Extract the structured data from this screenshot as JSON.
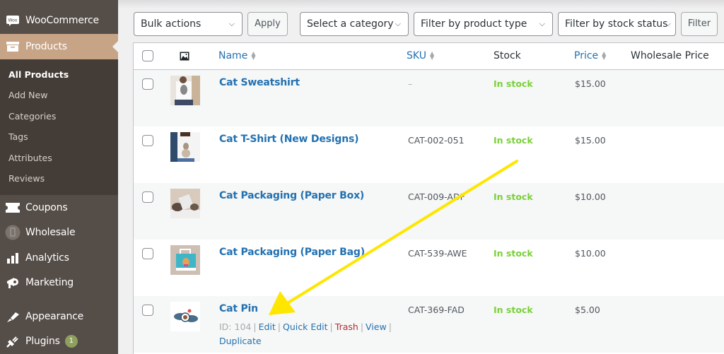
{
  "sidebar": {
    "items": [
      {
        "label": "WooCommerce",
        "icon": "woo-icon"
      },
      {
        "label": "Products",
        "icon": "archive-box-icon",
        "active": true
      },
      {
        "label": "Coupons",
        "icon": "ticket-icon"
      },
      {
        "label": "Wholesale",
        "icon": "wholesale-icon"
      },
      {
        "label": "Analytics",
        "icon": "bar-chart-icon"
      },
      {
        "label": "Marketing",
        "icon": "megaphone-icon"
      },
      {
        "label": "Appearance",
        "icon": "paintbrush-icon"
      },
      {
        "label": "Plugins",
        "icon": "plugin-icon",
        "badge": "1"
      }
    ],
    "submenu": [
      {
        "label": "All Products",
        "current": true
      },
      {
        "label": "Add New"
      },
      {
        "label": "Categories"
      },
      {
        "label": "Tags"
      },
      {
        "label": "Attributes"
      },
      {
        "label": "Reviews"
      }
    ],
    "woo_logo_text": "Woo"
  },
  "filters": {
    "bulk_actions": "Bulk actions",
    "apply": "Apply",
    "category": "Select a category",
    "product_type": "Filter by product type",
    "stock_status": "Filter by stock status",
    "filter": "Filter"
  },
  "table": {
    "headers": {
      "name": "Name",
      "sku": "SKU",
      "stock": "Stock",
      "price": "Price",
      "wholesale_price": "Wholesale Price"
    },
    "rows": [
      {
        "name": "Cat Sweatshirt",
        "sku": "–",
        "stock": "In stock",
        "price": "$15.00",
        "wholesale_price": ""
      },
      {
        "name": "Cat T-Shirt (New Designs)",
        "sku": "CAT-002-051",
        "stock": "In stock",
        "price": "$15.00",
        "wholesale_price": ""
      },
      {
        "name": "Cat Packaging (Paper Box)",
        "sku": "CAT-009-ADF",
        "stock": "In stock",
        "price": "$10.00",
        "wholesale_price": ""
      },
      {
        "name": "Cat Packaging (Paper Bag)",
        "sku": "CAT-539-AWE",
        "stock": "In stock",
        "price": "$10.00",
        "wholesale_price": ""
      },
      {
        "name": "Cat Pin",
        "sku": "CAT-369-FAD",
        "stock": "In stock",
        "price": "$5.00",
        "wholesale_price": "",
        "row_actions": {
          "id": "ID: 104",
          "edit": "Edit",
          "quick_edit": "Quick Edit",
          "trash": "Trash",
          "view": "View",
          "duplicate": "Duplicate"
        }
      }
    ]
  },
  "annotation": {
    "type": "arrow",
    "color": "#ffe600",
    "points_to": "Edit"
  },
  "colors": {
    "sidebar_bg": "#554d47",
    "sidebar_active": "#c8a487",
    "link": "#2271b1",
    "in_stock": "#7ad03a",
    "trash": "#b32d2e"
  }
}
